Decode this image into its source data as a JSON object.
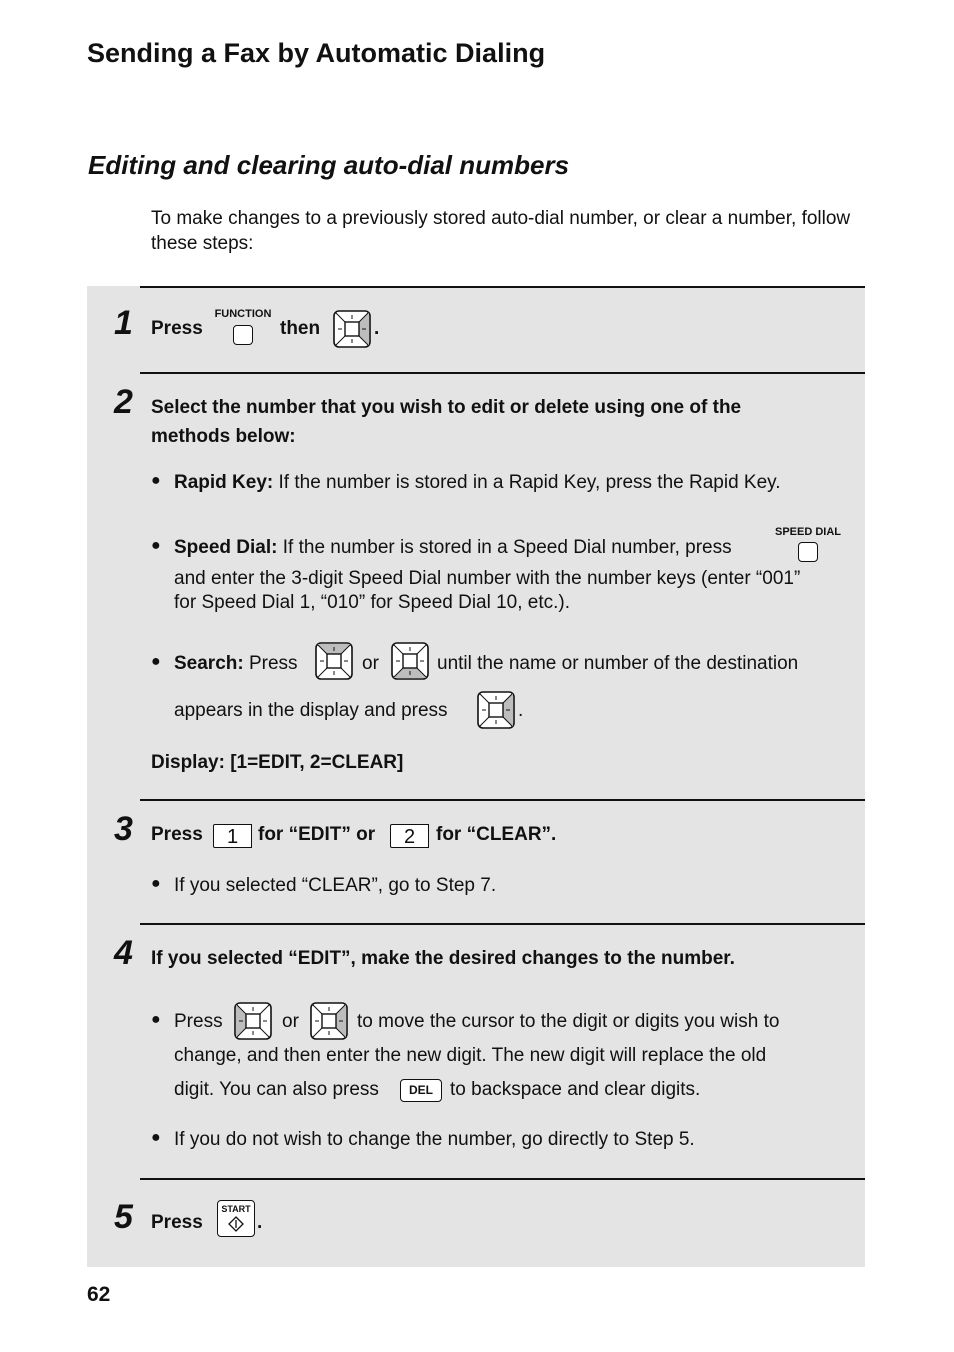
{
  "page_title": "Sending a Fax by Automatic Dialing",
  "section_title": "Editing and clearing auto-dial numbers",
  "intro": "To make changes to a previously stored auto-dial number, or clear a number, follow these steps:",
  "icons": {
    "nav": "navigation-pad-icon",
    "start": "start-diamond-icon"
  },
  "steps": [
    {
      "number": "1",
      "press": "Press",
      "function_label": "FUNCTION",
      "then": "then",
      "period": "."
    },
    {
      "number": "2",
      "heading_line1": "Select the number that you wish to edit or delete using one of the",
      "heading_line2": "methods below:",
      "rapid_key_label": "Rapid Key:",
      "rapid_key_text": "If the number is stored in a Rapid Key, press the Rapid Key.",
      "speed_dial_label": "Speed Dial:",
      "speed_dial_text1": "If the number is stored in a Speed Dial number, press",
      "speed_dial_key_label": "SPEED DIAL",
      "speed_dial_text2": "and enter the 3-digit Speed Dial number with the number keys (enter “001”",
      "speed_dial_text3": "for Speed Dial 1, “010” for Speed Dial 10, etc.).",
      "search_label": "Search:",
      "search_press": "Press",
      "search_or": "or",
      "search_text1": "until the name or number of the destination",
      "search_text2": "appears in the display and press",
      "search_period": ".",
      "display_text": "Display: [1=EDIT, 2=CLEAR]"
    },
    {
      "number": "3",
      "press": "Press",
      "key1": "1",
      "for_edit": "for “EDIT” or",
      "key2": "2",
      "for_clear": "for  “CLEAR”.",
      "bullet": "If you selected “CLEAR”, go to Step 7."
    },
    {
      "number": "4",
      "heading": "If you selected “EDIT”, make the desired changes to the number.",
      "press": "Press",
      "or": "or",
      "text1": "to move the cursor to the digit or digits you wish to",
      "text2": "change, and then enter the new digit. The new digit will replace the old",
      "text3a": "digit. You can also press",
      "del_label": "DEL",
      "text3b": "to backspace and clear digits.",
      "bullet2": "If you do not wish to change the number, go directly to Step 5."
    },
    {
      "number": "5",
      "press": "Press",
      "start_label": "START",
      "period": "."
    }
  ],
  "page_number": "62"
}
